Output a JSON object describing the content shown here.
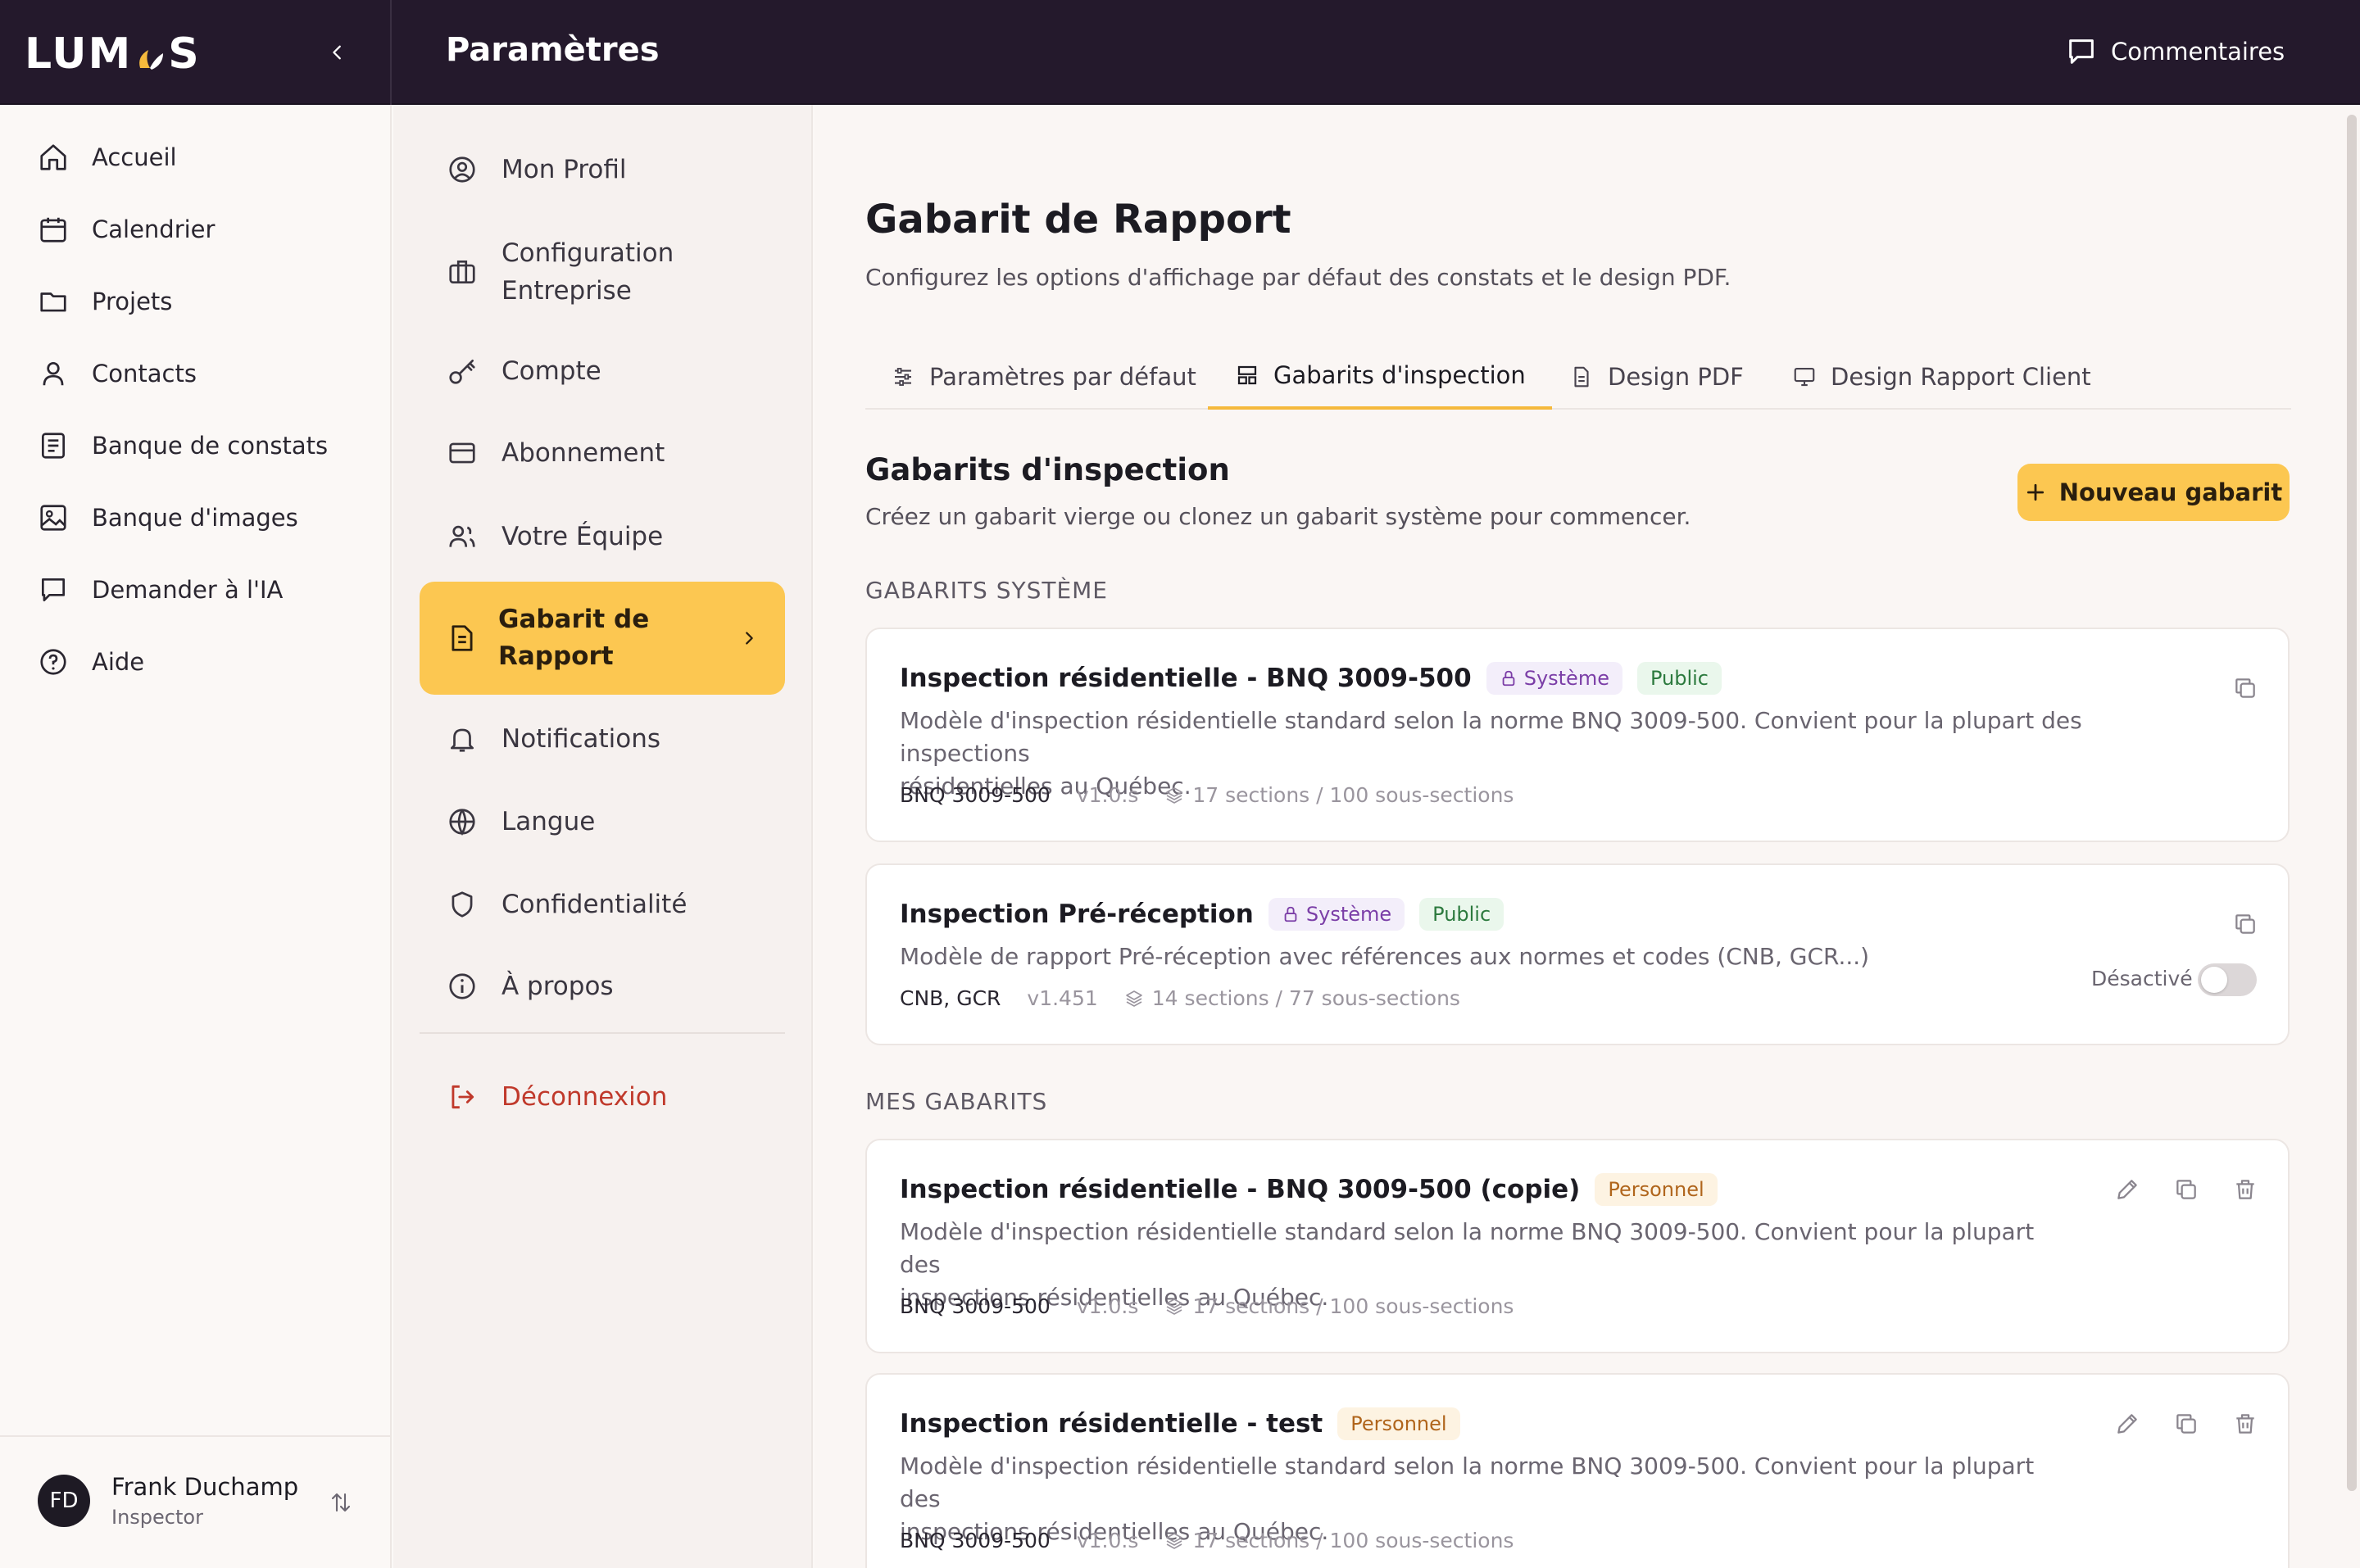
{
  "app": {
    "logo": "LUMOS",
    "page_header": "Paramètres",
    "comments_label": "Commentaires"
  },
  "sidebar": {
    "items": [
      {
        "label": "Accueil",
        "icon": "home-icon"
      },
      {
        "label": "Calendrier",
        "icon": "calendar-icon"
      },
      {
        "label": "Projets",
        "icon": "folder-icon"
      },
      {
        "label": "Contacts",
        "icon": "user-icon"
      },
      {
        "label": "Banque de constats",
        "icon": "document-list-icon"
      },
      {
        "label": "Banque d'images",
        "icon": "image-icon"
      },
      {
        "label": "Demander à l'IA",
        "icon": "chat-icon"
      },
      {
        "label": "Aide",
        "icon": "help-icon"
      }
    ],
    "user": {
      "initials": "FD",
      "name": "Frank Duchamp",
      "role": "Inspector"
    }
  },
  "settings_nav": {
    "items": [
      {
        "label": "Mon Profil",
        "icon": "profile-icon"
      },
      {
        "label": "Configuration Entreprise",
        "line1": "Configuration",
        "line2": "Entreprise",
        "icon": "briefcase-icon"
      },
      {
        "label": "Compte",
        "icon": "key-icon"
      },
      {
        "label": "Abonnement",
        "icon": "credit-card-icon"
      },
      {
        "label": "Votre Équipe",
        "icon": "team-icon"
      },
      {
        "label": "Gabarit de Rapport",
        "line1": "Gabarit de",
        "line2": "Rapport",
        "icon": "report-icon",
        "active": true
      },
      {
        "label": "Notifications",
        "icon": "bell-icon"
      },
      {
        "label": "Langue",
        "icon": "globe-icon"
      },
      {
        "label": "Confidentialité",
        "icon": "shield-icon"
      },
      {
        "label": "À propos",
        "icon": "info-icon"
      }
    ],
    "logout_label": "Déconnexion"
  },
  "main": {
    "title": "Gabarit de Rapport",
    "subtitle": "Configurez les options d'affichage par défaut des constats et le design PDF.",
    "tabs": [
      {
        "label": "Paramètres par défaut",
        "icon": "sliders-icon"
      },
      {
        "label": "Gabarits d'inspection",
        "icon": "layout-icon",
        "active": true
      },
      {
        "label": "Design PDF",
        "icon": "file-icon"
      },
      {
        "label": "Design Rapport Client",
        "icon": "monitor-icon"
      }
    ],
    "section_title": "Gabarits d'inspection",
    "section_subtitle": "Créez un gabarit vierge ou clonez un gabarit système pour commencer.",
    "new_button_label": "Nouveau gabarit",
    "system_group_label": "GABARITS SYSTÈME",
    "mine_group_label": "MES GABARITS",
    "system_templates": [
      {
        "title": "Inspection résidentielle - BNQ 3009-500",
        "badges": [
          "Système",
          "Public"
        ],
        "description_line1": "Modèle d'inspection résidentielle standard selon la norme BNQ 3009-500. Convient pour la plupart des inspections",
        "description_line2": "résidentielles au Québec.",
        "code": "BNQ 3009-500",
        "version": "v1.0.s",
        "sections": "17 sections / 100 sous-sections"
      },
      {
        "title": "Inspection Pré-réception",
        "badges": [
          "Système",
          "Public"
        ],
        "description_line1": "Modèle de rapport Pré-réception avec références aux normes et codes (CNB, GCR...)",
        "code": "CNB, GCR",
        "version": "v1.451",
        "sections": "14 sections / 77 sous-sections",
        "toggle_label": "Désactivé",
        "toggle_on": false
      }
    ],
    "my_templates": [
      {
        "title": "Inspection résidentielle - BNQ 3009-500 (copie)",
        "badge": "Personnel",
        "description_line1": "Modèle d'inspection résidentielle standard selon la norme BNQ 3009-500. Convient pour la plupart des",
        "description_line2": "inspections résidentielles au Québec.",
        "code": "BNQ 3009-500",
        "version": "v1.0.s",
        "sections": "17 sections / 100 sous-sections"
      },
      {
        "title": "Inspection résidentielle - test",
        "badge": "Personnel",
        "description_line1": "Modèle d'inspection résidentielle standard selon la norme BNQ 3009-500. Convient pour la plupart des",
        "description_line2": "inspections résidentielles au Québec.",
        "code": "BNQ 3009-500",
        "version": "v1.0.s",
        "sections": "17 sections / 100 sous-sections"
      }
    ]
  },
  "colors": {
    "topbar": "#24192c",
    "accent": "#fcc751",
    "logout": "#c0392b"
  }
}
